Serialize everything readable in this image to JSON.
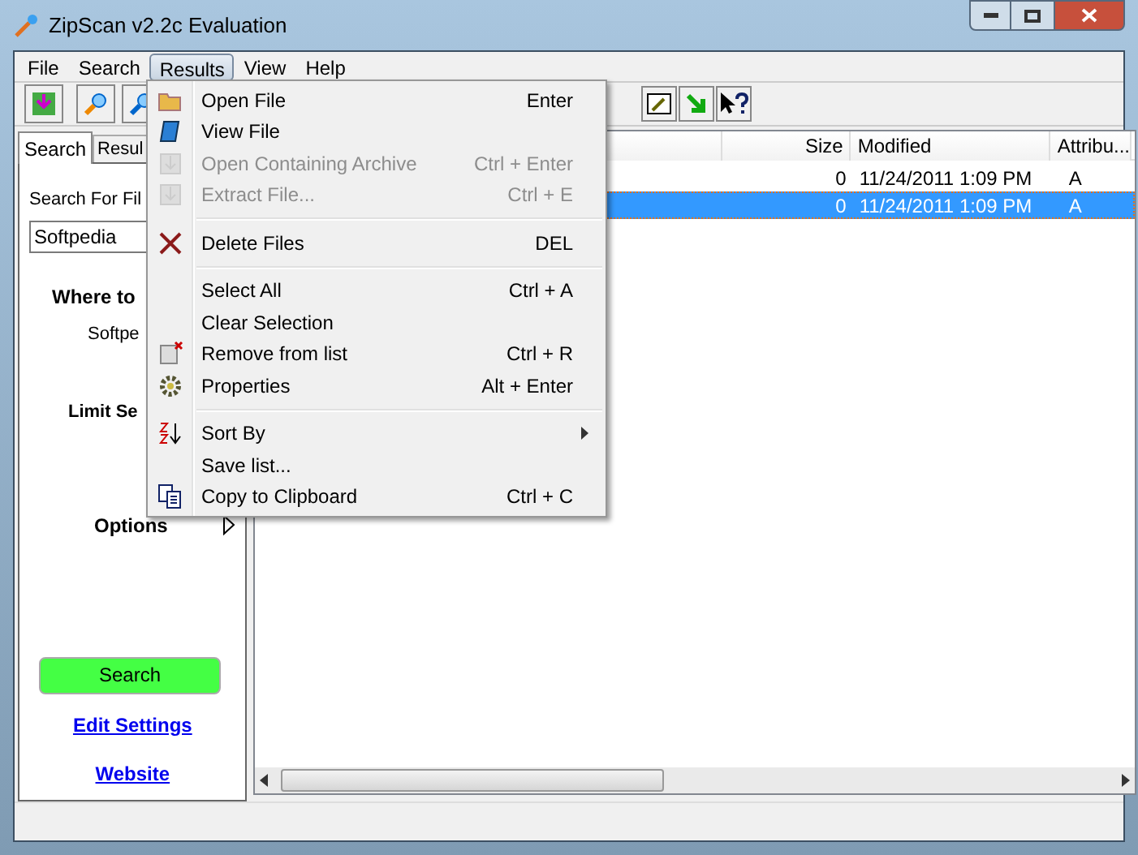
{
  "window": {
    "title": "ZipScan v2.2c Evaluation"
  },
  "menubar": [
    {
      "label": "File",
      "selected": false
    },
    {
      "label": "Search",
      "selected": false
    },
    {
      "label": "Results",
      "selected": true
    },
    {
      "label": "View",
      "selected": false
    },
    {
      "label": "Help",
      "selected": false
    }
  ],
  "left_tabs": [
    {
      "label": "Search",
      "selected": true
    },
    {
      "label": "Resul",
      "selected": false
    }
  ],
  "search_panel": {
    "search_for_label": "Search For Fil",
    "search_value": "Softpedia",
    "where_to_label": "Where to",
    "where_value": "Softpe",
    "limit_label": "Limit Se",
    "options_label": "Options",
    "search_button": "Search",
    "edit_settings_link": "Edit Settings",
    "website_link": "Website"
  },
  "table": {
    "columns": [
      "",
      "Size",
      "Modified",
      "Attribu..."
    ],
    "rows": [
      {
        "cells": [
          "",
          "0",
          "11/24/2011 1:09 PM",
          "A"
        ],
        "selected": false
      },
      {
        "cells": [
          "",
          "0",
          "11/24/2011 1:09 PM",
          "A"
        ],
        "selected": true
      }
    ]
  },
  "results_menu": [
    {
      "kind": "item",
      "label": "Open File",
      "shortcut": "Enter",
      "disabled": false
    },
    {
      "kind": "item",
      "label": "View File",
      "disabled": false
    },
    {
      "kind": "item",
      "label": "Open Containing Archive",
      "shortcut": "Ctrl + Enter",
      "disabled": true
    },
    {
      "kind": "item",
      "label": "Extract File...",
      "shortcut": "Ctrl + E",
      "disabled": true
    },
    {
      "kind": "separator"
    },
    {
      "kind": "item",
      "label": "Delete Files",
      "shortcut": "DEL",
      "disabled": false
    },
    {
      "kind": "separator"
    },
    {
      "kind": "item",
      "label": "Select All",
      "shortcut": "Ctrl + A",
      "disabled": false
    },
    {
      "kind": "item",
      "label": "Clear Selection",
      "disabled": false
    },
    {
      "kind": "item",
      "label": "Remove from list",
      "shortcut": "Ctrl + R",
      "disabled": false
    },
    {
      "kind": "item",
      "label": "Properties",
      "shortcut": "Alt + Enter",
      "disabled": false
    },
    {
      "kind": "separator"
    },
    {
      "kind": "submenu",
      "label": "Sort By",
      "disabled": false
    },
    {
      "kind": "item",
      "label": "Save list...",
      "disabled": false
    },
    {
      "kind": "item",
      "label": "Copy to Clipboard",
      "shortcut": "Ctrl + C",
      "disabled": false
    }
  ]
}
